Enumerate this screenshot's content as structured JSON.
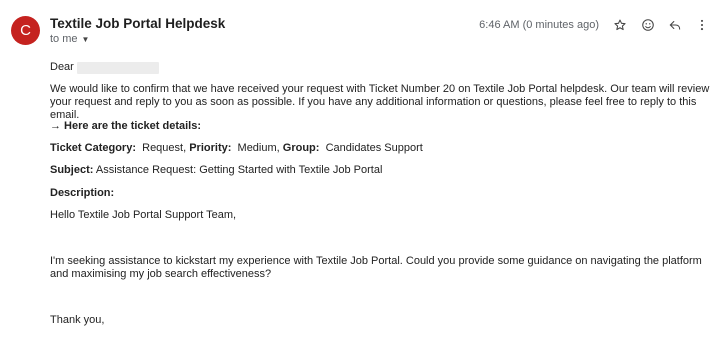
{
  "avatar": {
    "letter": "C",
    "color": "#c5221f"
  },
  "sender": {
    "name": "Textile Job Portal Helpdesk"
  },
  "recipient": {
    "label": "to me"
  },
  "timestamp": "6:46 AM (0 minutes ago)",
  "actions": {
    "star": "star-icon",
    "emoji": "emoji-icon",
    "reply": "reply-icon",
    "more": "more-vert-icon"
  },
  "email": {
    "greeting": "Dear",
    "intro": "We would like to confirm that we have received your request with Ticket Number 20 on Textile Job Portal helpdesk. Our team will review your request and reply to you as soon as possible. If you have any additional information or questions, please feel free to reply to this email.",
    "details_heading": "→ Here are the ticket details:",
    "category_label": "Ticket Category:",
    "category_value": "Request,",
    "priority_label": "Priority:",
    "priority_value": "Medium,",
    "group_label": "Group:",
    "group_value": "Candidates Support",
    "subject_label": "Subject:",
    "subject_value": "Assistance Request: Getting Started with Textile Job Portal",
    "description_label": "Description:",
    "description_greeting": "Hello Textile Job Portal Support Team,",
    "description_body": "I'm seeking assistance to kickstart my experience with Textile Job Portal. Could you provide some guidance on navigating the platform and maximising my job search effectiveness?",
    "signoff": "Thank you,"
  }
}
